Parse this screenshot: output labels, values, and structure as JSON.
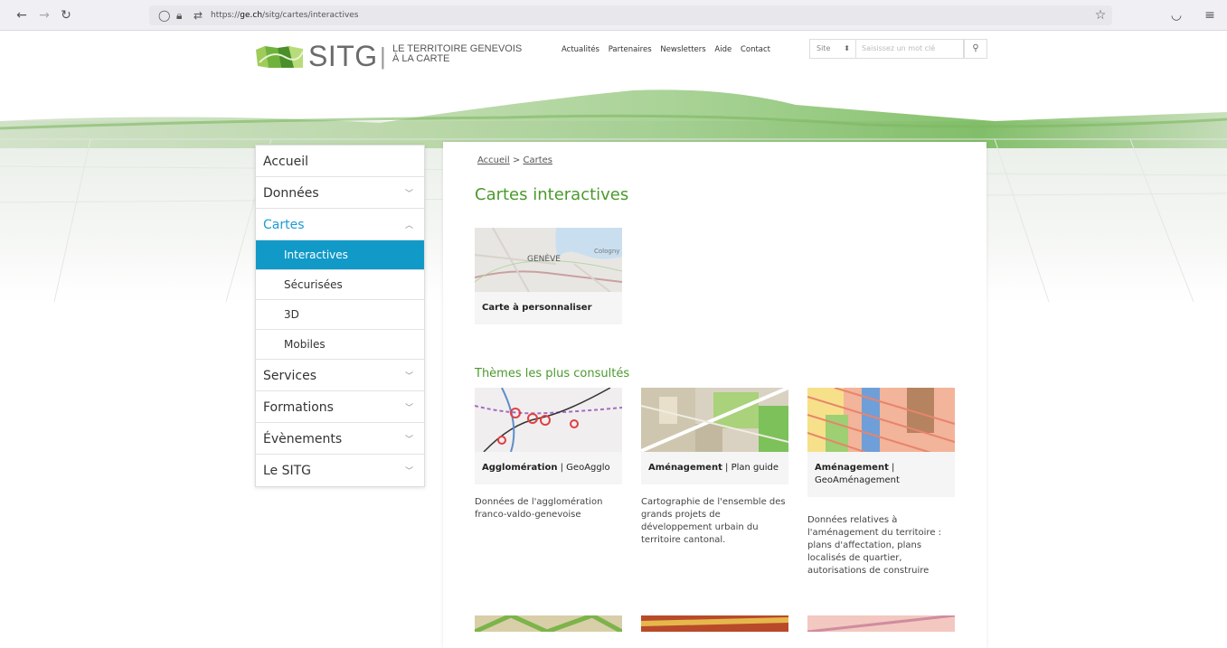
{
  "browser": {
    "url_prefix": "https://",
    "url_domain": "ge.ch",
    "url_path": "/sitg/cartes/interactives"
  },
  "header": {
    "logo_text": "SITG",
    "logo_sep": "|",
    "tagline_line1": "LE TERRITOIRE GENEVOIS",
    "tagline_line2": "À LA CARTE",
    "nav": [
      "Actualités",
      "Partenaires",
      "Newsletters",
      "Aide",
      "Contact"
    ],
    "search_scope": "Site",
    "search_placeholder": "Saisissez un mot clé"
  },
  "sidebar": {
    "items": [
      {
        "label": "Accueil"
      },
      {
        "label": "Données"
      },
      {
        "label": "Cartes"
      },
      {
        "label": "Services"
      },
      {
        "label": "Formations"
      },
      {
        "label": "Évènements"
      },
      {
        "label": "Le SITG"
      }
    ],
    "sub_items": [
      {
        "label": "Interactives"
      },
      {
        "label": "Sécurisées"
      },
      {
        "label": "3D"
      },
      {
        "label": "Mobiles"
      }
    ]
  },
  "main": {
    "breadcrumb_home": "Accueil",
    "breadcrumb_sep": ">",
    "breadcrumb_current": "Cartes",
    "title": "Cartes interactives",
    "custom_card": {
      "label": "Carte à personnaliser",
      "map_label_geneve": "GENÈVE",
      "map_label_cologny": "Cologny"
    },
    "section_title": "Thèmes les plus consultés",
    "themes": [
      {
        "title_bold": "Agglomération",
        "title_rest": "| GeoAgglo",
        "description": "Données de l'agglomération franco-valdo-genevoise"
      },
      {
        "title_bold": "Aménagement",
        "title_rest": "| Plan guide",
        "description": "Cartographie de l'ensemble des grands projets de développement urbain du territoire cantonal."
      },
      {
        "title_bold": "Aménagement",
        "title_rest": "| GeoAménagement",
        "description": "Données relatives à l'aménagement du territoire : plans d'affectation, plans localisés de quartier, autorisations de construire"
      }
    ]
  },
  "colors": {
    "accent_green": "#4a9a2c",
    "active_blue": "#119ac8",
    "link_blue": "#1d9ad6"
  }
}
